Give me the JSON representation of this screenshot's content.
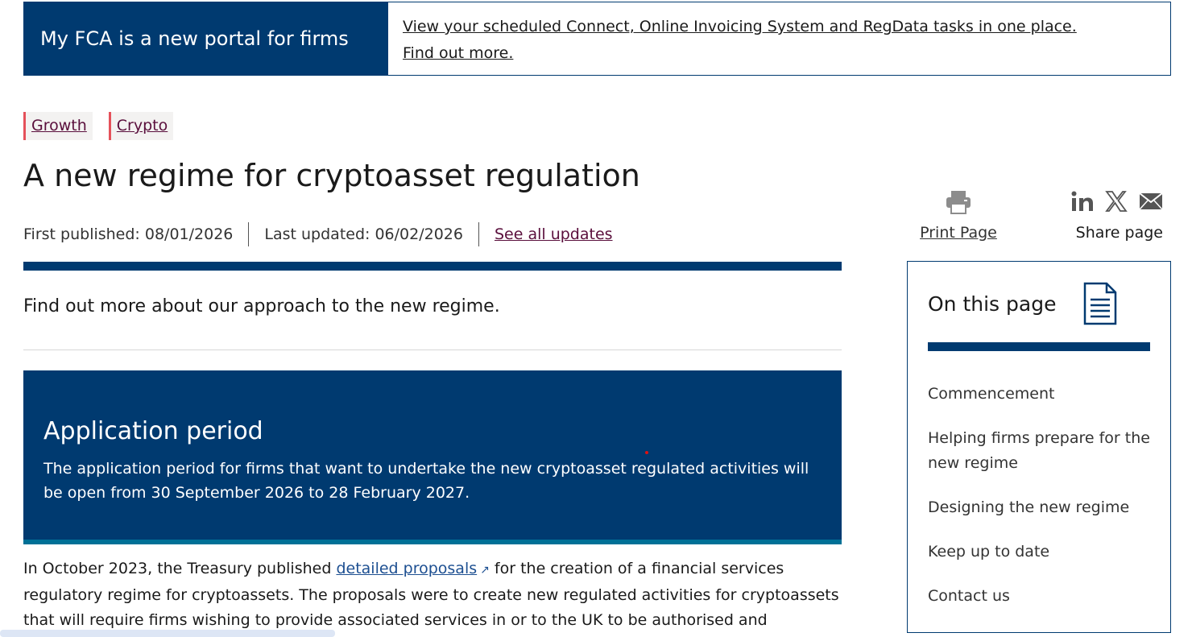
{
  "banner": {
    "title": "My FCA is a new portal for firms",
    "link_line1": "View your scheduled Connect, Online Invoicing System and RegData tasks in one place.",
    "link_line2": "Find out more."
  },
  "tags": [
    "Growth",
    "Crypto"
  ],
  "page_title": "A new regime for cryptoasset regulation",
  "meta": {
    "first_published": "First published: 08/01/2026",
    "last_updated": "Last updated: 06/02/2026",
    "see_all": "See all updates"
  },
  "lead": "Find out more about our approach to the new regime.",
  "callout": {
    "heading": "Application period",
    "text": "The application period for firms that want to undertake the new cryptoasset regulated activities will be open from 30 September 2026 to 28 February 2027."
  },
  "body": {
    "before_link": "In October 2023, the Treasury published ",
    "link": "detailed proposals",
    "after_link": " for the creation of a financial services regulatory regime for cryptoassets. The proposals were to create new regulated activities for cryptoassets that will require firms wishing to provide associated services in or to the UK to be authorised and"
  },
  "tools": {
    "print": "Print Page",
    "share": "Share page",
    "share_icons": [
      "linkedin-icon",
      "x-icon",
      "email-icon"
    ]
  },
  "on_this_page": {
    "title": "On this page",
    "items": [
      "Commencement",
      "Helping firms prepare for the new regime",
      "Designing the new regime",
      "Keep up to date",
      "Contact us"
    ]
  },
  "colors": {
    "navy": "#003a70",
    "tag_border": "#e5515a",
    "link_purple": "#5a0f3c",
    "link_blue": "#1d4f91",
    "teal_border": "#007096"
  }
}
